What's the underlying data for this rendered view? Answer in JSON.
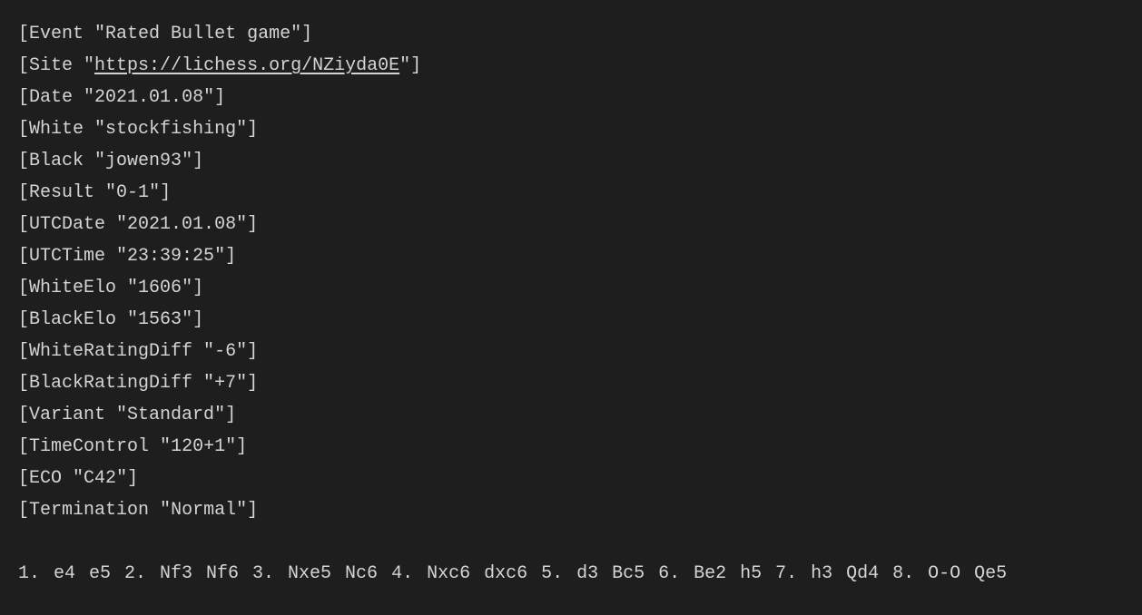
{
  "pgn": {
    "headers": [
      {
        "key": "Event",
        "value": "Rated Bullet game",
        "has_link": false
      },
      {
        "key": "Site",
        "value_prefix": "",
        "link_text": "https://lichess.org/NZiyda0E",
        "value_suffix": "",
        "has_link": true
      },
      {
        "key": "Date",
        "value": "2021.01.08",
        "has_link": false
      },
      {
        "key": "White",
        "value": "stockfishing",
        "has_link": false
      },
      {
        "key": "Black",
        "value": "jowen93",
        "has_link": false
      },
      {
        "key": "Result",
        "value": "0-1",
        "has_link": false
      },
      {
        "key": "UTCDate",
        "value": "2021.01.08",
        "has_link": false
      },
      {
        "key": "UTCTime",
        "value": "23:39:25",
        "has_link": false
      },
      {
        "key": "WhiteElo",
        "value": "1606",
        "has_link": false
      },
      {
        "key": "BlackElo",
        "value": "1563",
        "has_link": false
      },
      {
        "key": "WhiteRatingDiff",
        "value": "-6",
        "has_link": false
      },
      {
        "key": "BlackRatingDiff",
        "value": "+7",
        "has_link": false
      },
      {
        "key": "Variant",
        "value": "Standard",
        "has_link": false
      },
      {
        "key": "TimeControl",
        "value": "120+1",
        "has_link": false
      },
      {
        "key": "ECO",
        "value": "C42",
        "has_link": false
      },
      {
        "key": "Termination",
        "value": "Normal",
        "has_link": false
      }
    ],
    "moves": "1. e4 e5 2. Nf3 Nf6 3. Nxe5 Nc6 4. Nxc6 dxc6 5. d3 Bc5 6. Be2 h5 7. h3 Qd4 8. O-O Qe5"
  }
}
